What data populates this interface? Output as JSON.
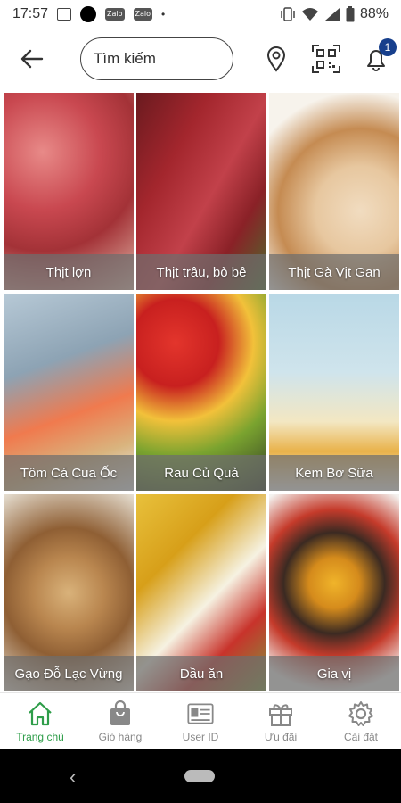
{
  "status_bar": {
    "time": "17:57",
    "battery": "88%",
    "icons": [
      "message-icon",
      "dot-icon",
      "zalo-icon",
      "zalo-icon",
      "dot-icon",
      "vibrate-icon",
      "wifi-icon",
      "signal-icon",
      "battery-icon"
    ],
    "zalo_label": "Zalo"
  },
  "header": {
    "search_placeholder": "Tìm kiếm",
    "notification_count": "1",
    "accent_color": "#173f8c"
  },
  "categories": [
    {
      "label": "Thịt lợn",
      "icon": "pork-photo"
    },
    {
      "label": "Thịt trâu, bò bê",
      "icon": "beef-photo"
    },
    {
      "label": "Thịt Gà Vịt Gan",
      "icon": "poultry-photo"
    },
    {
      "label": "Tôm Cá Cua Ốc",
      "icon": "seafood-photo"
    },
    {
      "label": "Rau Củ Quả",
      "icon": "vegetables-photo"
    },
    {
      "label": "Kem  Bơ Sữa",
      "icon": "dairy-photo"
    },
    {
      "label": "Gạo Đỗ Lạc Vừng",
      "icon": "grains-photo"
    },
    {
      "label": "Dầu ăn",
      "icon": "cooking-oil-photo"
    },
    {
      "label": "Gia vị",
      "icon": "spices-photo"
    }
  ],
  "bottom_nav": {
    "active_color": "#2e9d49",
    "items": [
      {
        "label": "Trang chủ",
        "icon": "home-icon"
      },
      {
        "label": "Giỏ hàng",
        "icon": "shopping-bag-icon"
      },
      {
        "label": "User ID",
        "icon": "id-card-icon"
      },
      {
        "label": "Ưu đãi",
        "icon": "gift-icon"
      },
      {
        "label": "Cài đặt",
        "icon": "gear-icon"
      }
    ]
  }
}
